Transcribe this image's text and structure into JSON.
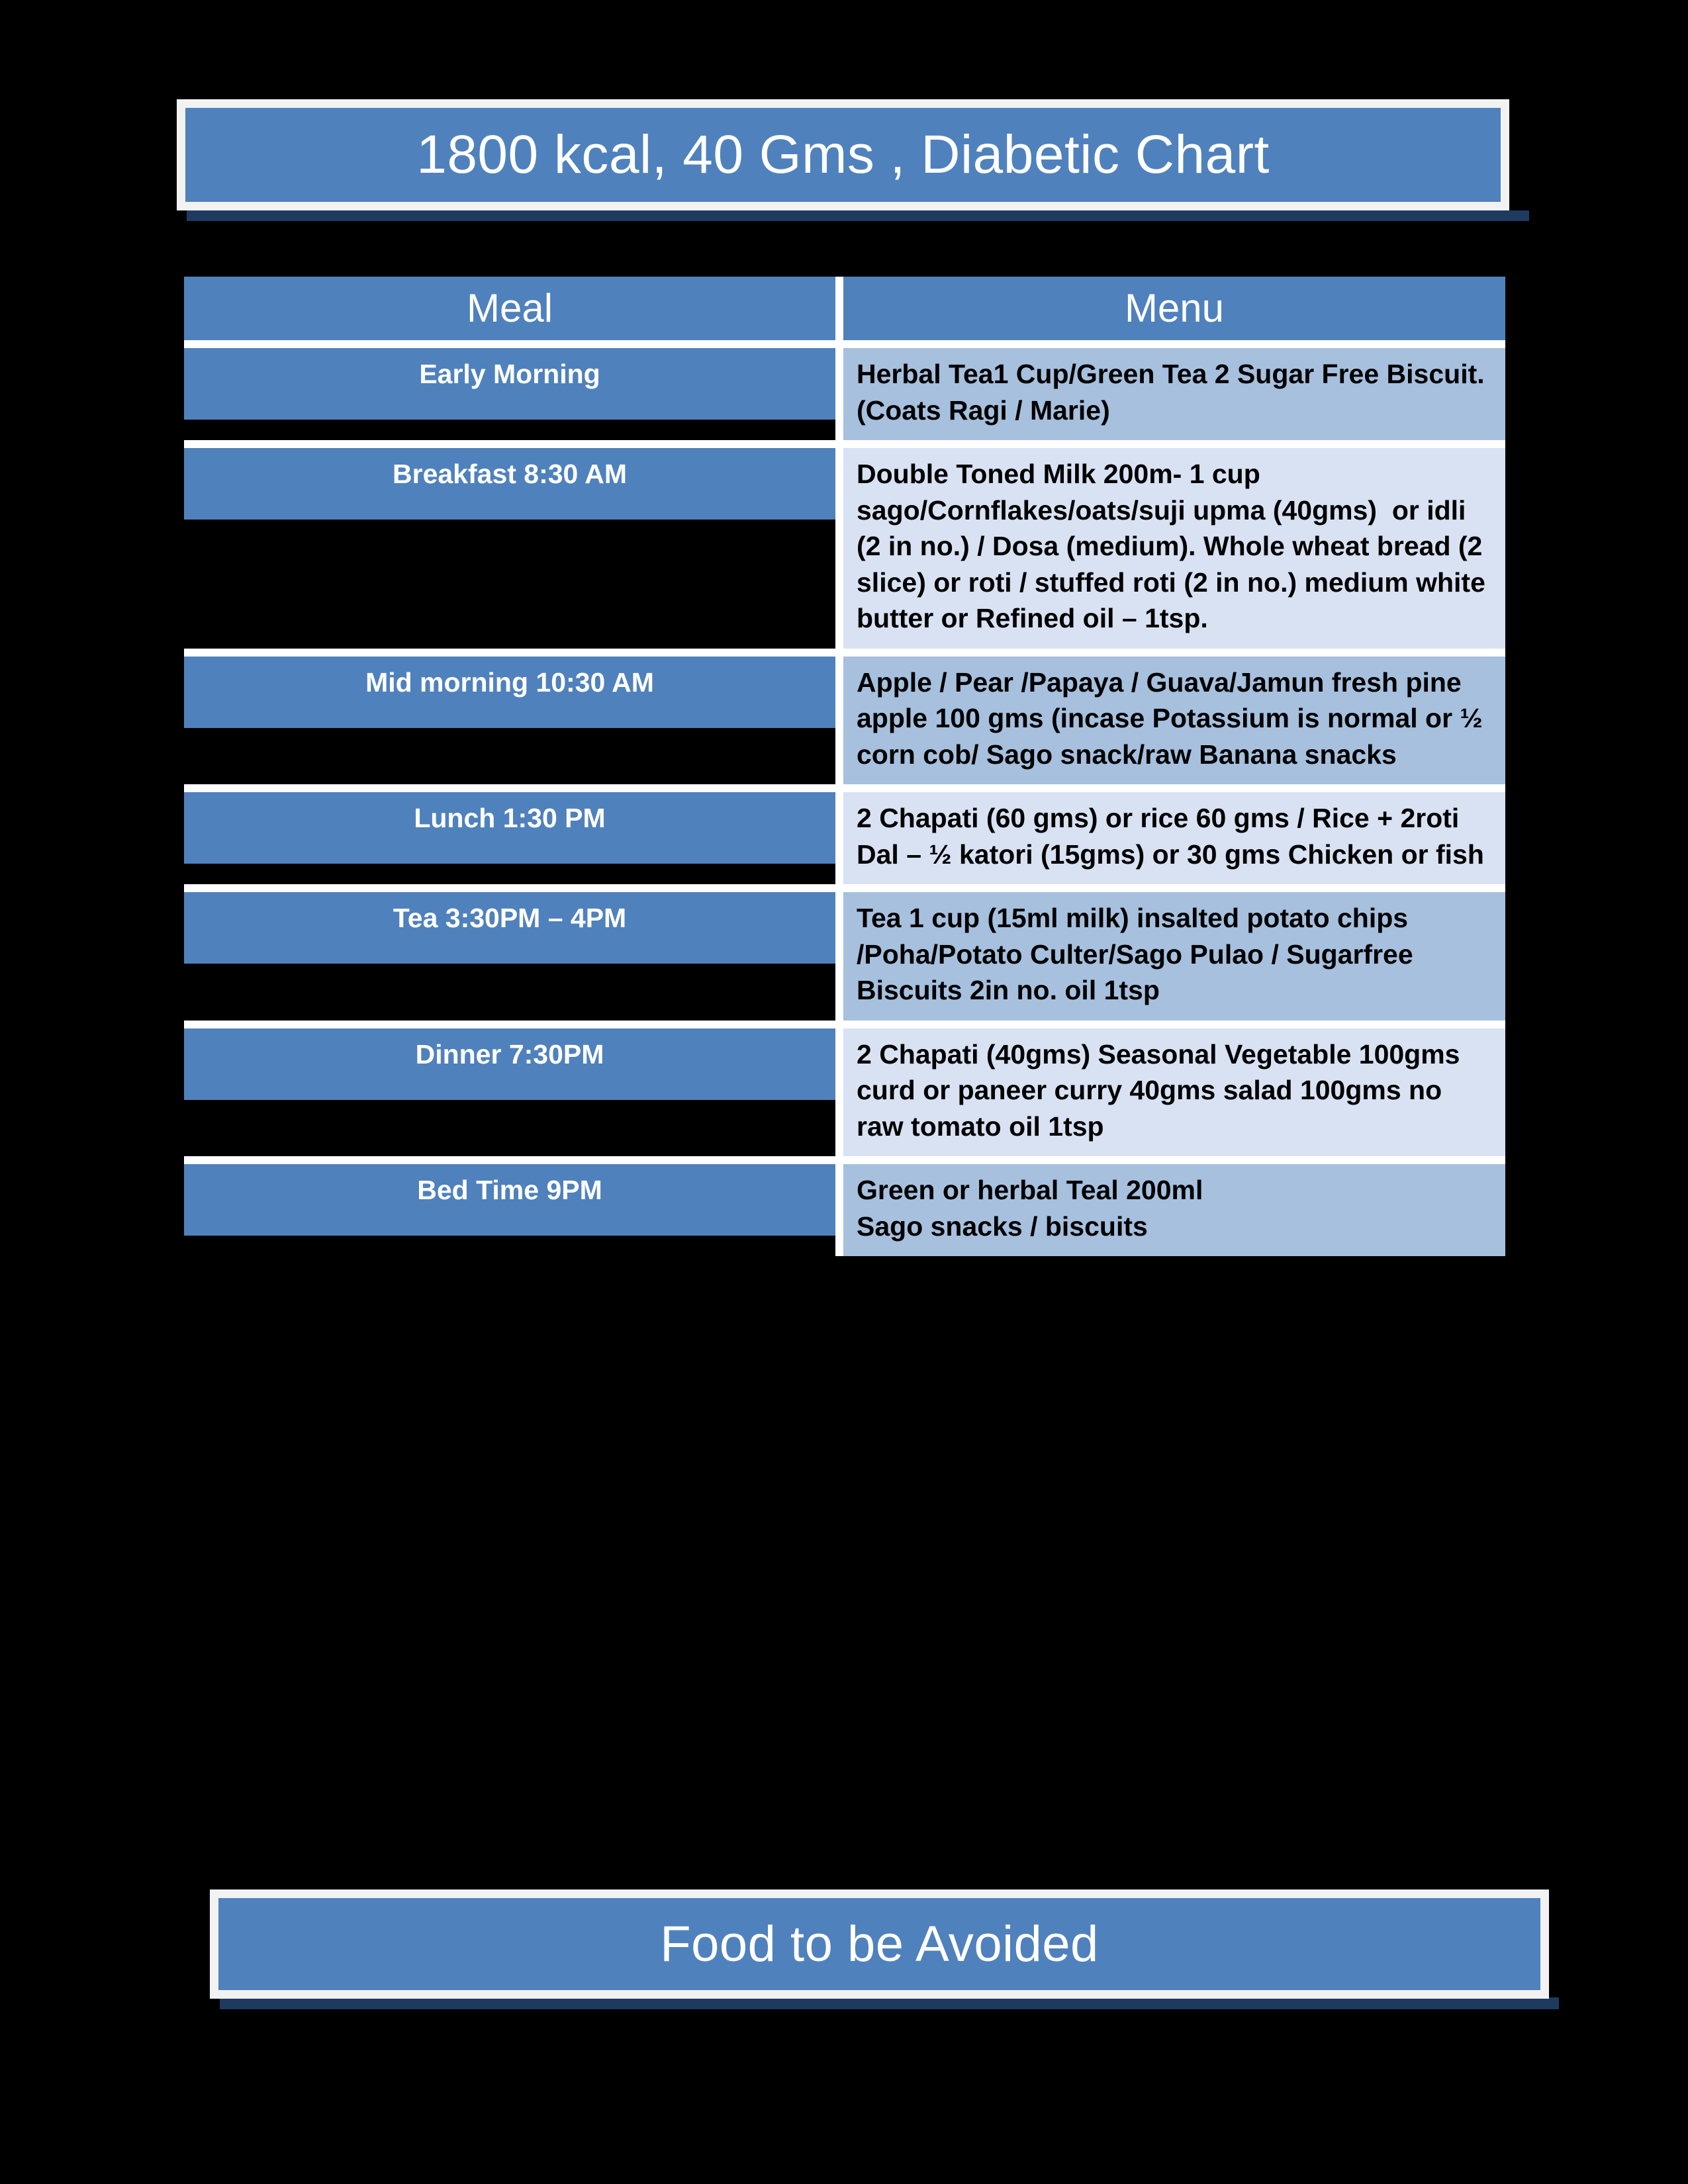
{
  "title_banner": {
    "text": "1800 kcal, 40 Gms , Diabetic Chart",
    "bg_color": "#4f81bd",
    "text_color": "#ffffff",
    "border_color": "#f2f2f2",
    "shadow_color": "#1f3a5f"
  },
  "table": {
    "headers": {
      "meal": "Meal",
      "menu": "Menu"
    },
    "header_bg": "#4f81bd",
    "row_bg_dark": "#a6c0de",
    "row_bg_light": "#d9e2f3",
    "meal_col_bg": "#4f81bd",
    "rows": [
      {
        "meal": "Early Morning",
        "menu": "Herbal Tea1 Cup/Green Tea 2 Sugar Free Biscuit.(Coats Ragi / Marie)"
      },
      {
        "meal": "Breakfast 8:30 AM",
        "menu": "Double Toned Milk 200m- 1 cup sago/Cornflakes/oats/suji upma (40gms)  or idli (2 in no.) / Dosa (medium). Whole wheat bread (2 slice) or roti / stuffed roti (2 in no.) medium white butter or Refined oil – 1tsp."
      },
      {
        "meal": "Mid morning 10:30 AM",
        "menu": "Apple / Pear /Papaya / Guava/Jamun fresh pine apple 100 gms (incase Potassium is normal or ½ corn cob/ Sago snack/raw Banana snacks"
      },
      {
        "meal": "Lunch 1:30 PM",
        "menu": "2 Chapati (60 gms) or rice 60 gms / Rice + 2roti Dal – ½ katori (15gms) or 30 gms Chicken or fish"
      },
      {
        "meal": "Tea 3:30PM – 4PM",
        "menu": "Tea 1 cup (15ml milk) insalted potato chips /Poha/Potato Culter/Sago Pulao / Sugarfree Biscuits 2in no. oil 1tsp"
      },
      {
        "meal": "Dinner 7:30PM",
        "menu": "2 Chapati (40gms) Seasonal Vegetable 100gms curd or paneer curry 40gms salad 100gms no raw tomato oil 1tsp"
      },
      {
        "meal": "Bed Time 9PM",
        "menu": "Green or herbal Teal 200ml\nSago snacks / biscuits"
      }
    ]
  },
  "footer_banner": {
    "text": "Food to be Avoided",
    "bg_color": "#4f81bd",
    "text_color": "#ffffff",
    "border_color": "#f2f2f2",
    "shadow_color": "#1f3a5f"
  }
}
